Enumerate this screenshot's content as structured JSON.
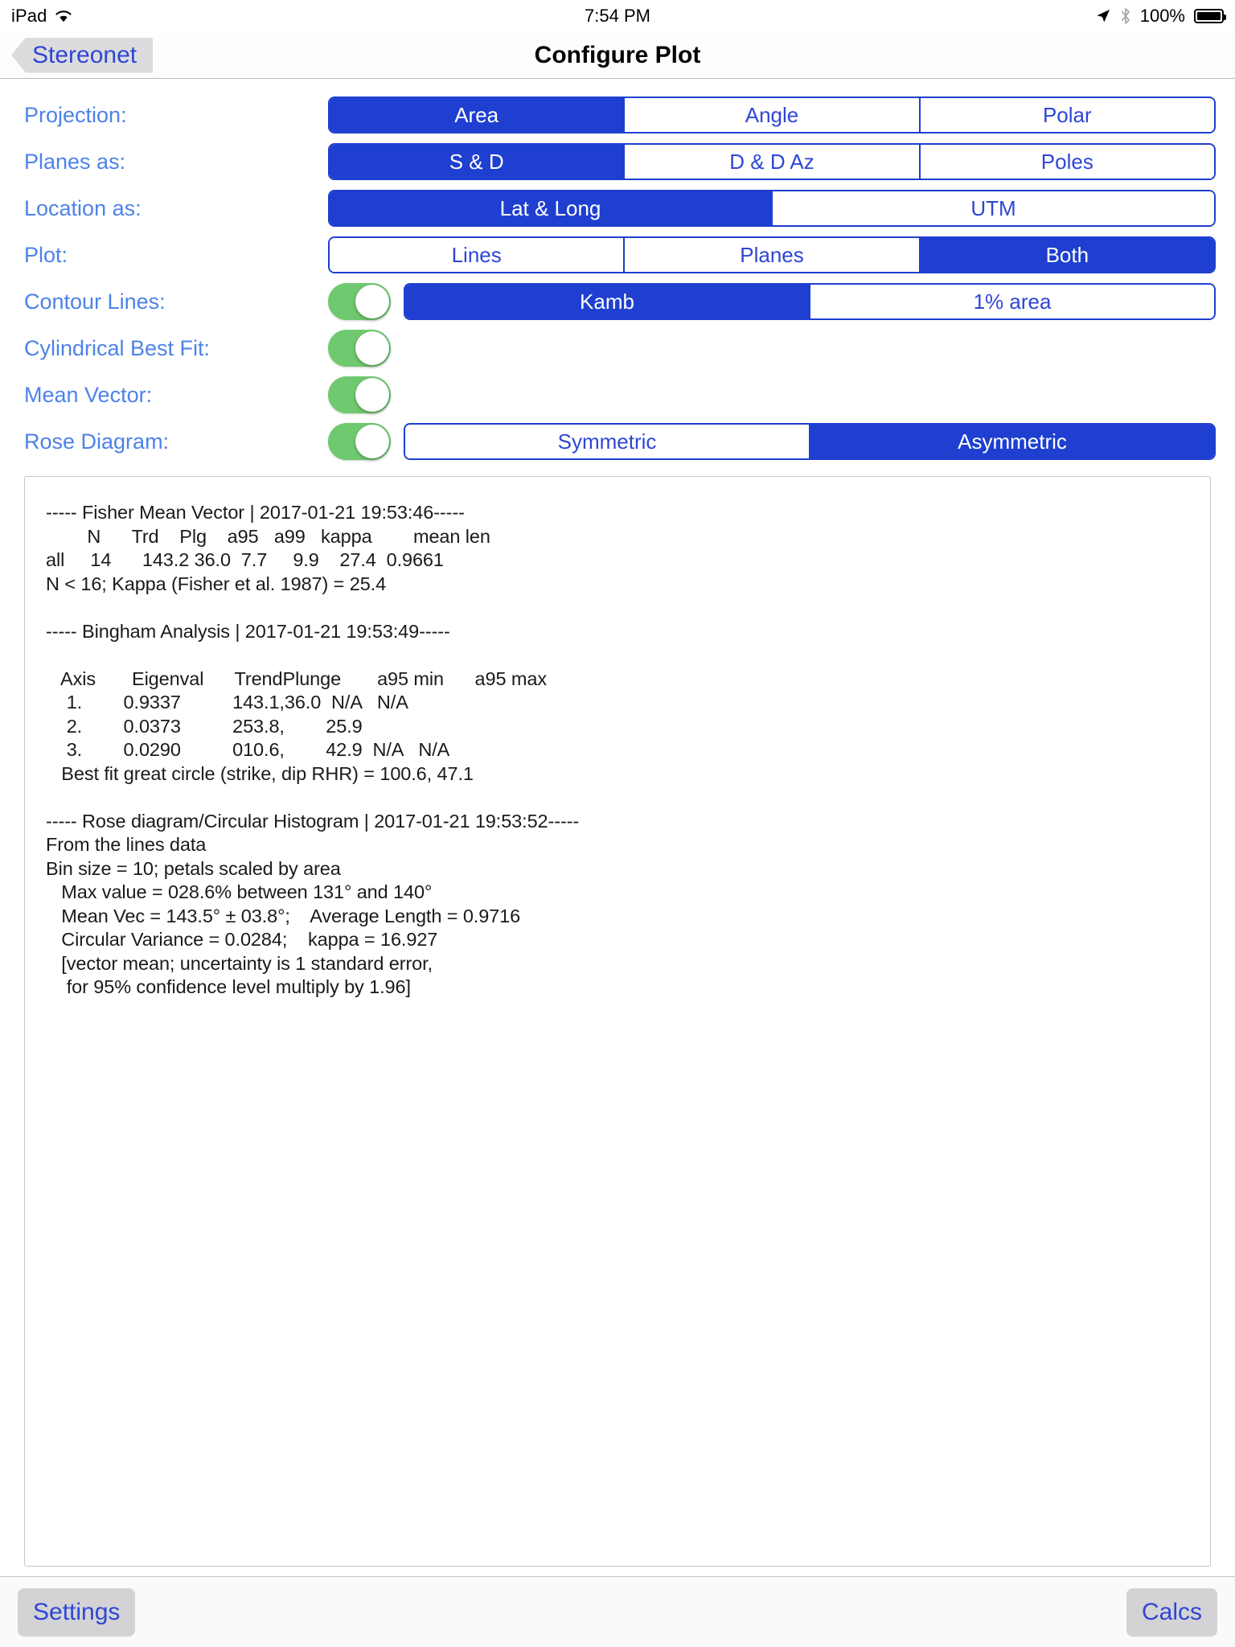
{
  "status_bar": {
    "device": "iPad",
    "wifi_icon": "wifi-icon",
    "time": "7:54 PM",
    "location_icon": "location-arrow-icon",
    "bluetooth_icon": "bluetooth-icon",
    "battery_percent": "100%",
    "battery_icon": "battery-full-icon"
  },
  "nav_bar": {
    "back_label": "Stereonet",
    "back_icon": "chevron-left-icon",
    "title": "Configure Plot"
  },
  "colors": {
    "accent_blue": "#1e3fd0",
    "label_blue": "#4d82e8",
    "toggle_green": "#6fc96e",
    "tint_text": "#2f46d4"
  },
  "rows": [
    {
      "label": "Projection:",
      "name": "projection",
      "toggle": null,
      "segments": [
        "Area",
        "Angle",
        "Polar"
      ],
      "selected": 0
    },
    {
      "label": "Planes as:",
      "name": "planes-as",
      "toggle": null,
      "segments": [
        "S & D",
        "D & D Az",
        "Poles"
      ],
      "selected": 0
    },
    {
      "label": "Location as:",
      "name": "location-as",
      "toggle": null,
      "segments": [
        "Lat & Long",
        "UTM"
      ],
      "selected": 0
    },
    {
      "label": "Plot:",
      "name": "plot",
      "toggle": null,
      "segments": [
        "Lines",
        "Planes",
        "Both"
      ],
      "selected": 2
    },
    {
      "label": "Contour Lines:",
      "name": "contour-lines",
      "toggle": "on",
      "segments": [
        "Kamb",
        "1% area"
      ],
      "selected": 0
    },
    {
      "label": "Cylindrical Best Fit:",
      "name": "cylindrical-best-fit",
      "toggle": "on",
      "segments": [],
      "selected": -1
    },
    {
      "label": "Mean Vector:",
      "name": "mean-vector",
      "toggle": "on",
      "segments": [],
      "selected": -1
    },
    {
      "label": "Rose Diagram:",
      "name": "rose-diagram",
      "toggle": "on",
      "segments": [
        "Symmetric",
        "Asymmetric"
      ],
      "selected": 1
    }
  ],
  "report": {
    "text": "----- Fisher Mean Vector | 2017-01-21 19:53:46-----\n        N      Trd    Plg    a95   a99   kappa        mean len\nall     14      143.2 36.0  7.7     9.9    27.4  0.9661\nN < 16; Kappa (Fisher et al. 1987) = 25.4\n\n----- Bingham Analysis | 2017-01-21 19:53:49-----\n\n   Axis       Eigenval      TrendPlunge       a95 min      a95 max\n    1.        0.9337          143.1,36.0  N/A   N/A\n    2.        0.0373          253.8,        25.9\n    3.        0.0290          010.6,        42.9  N/A   N/A\n   Best fit great circle (strike, dip RHR) = 100.6, 47.1\n\n----- Rose diagram/Circular Histogram | 2017-01-21 19:53:52-----\nFrom the lines data\nBin size = 10; petals scaled by area\n   Max value = 028.6% between 131° and 140°\n   Mean Vec = 143.5° ± 03.8°;    Average Length = 0.9716\n   Circular Variance = 0.0284;    kappa = 16.927\n   [vector mean; uncertainty is 1 standard error,\n    for 95% confidence level multiply by 1.96]"
  },
  "toolbar": {
    "settings_label": "Settings",
    "calcs_label": "Calcs"
  }
}
